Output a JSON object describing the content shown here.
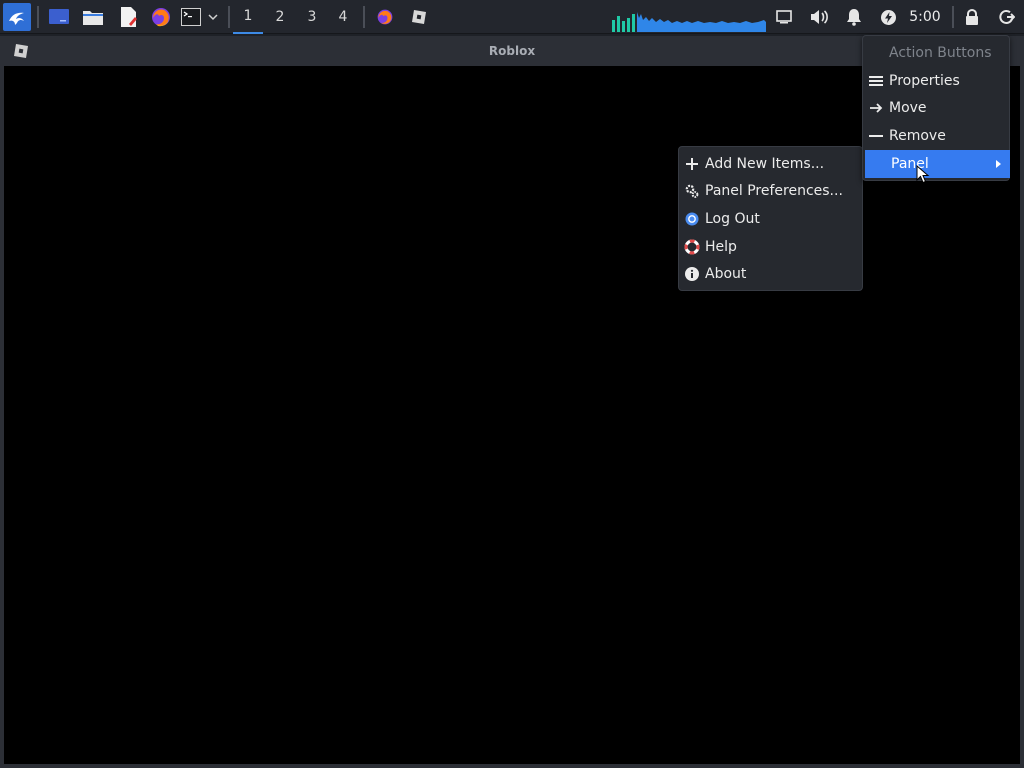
{
  "window": {
    "title": "Roblox"
  },
  "panel": {
    "workspaces": [
      "1",
      "2",
      "3",
      "4"
    ],
    "active_workspace": "1",
    "clock": "5:00",
    "accent_color": "#3d8ae6"
  },
  "context_menu": {
    "header": "Action Buttons",
    "items": [
      {
        "label": "Properties",
        "icon": "list-icon"
      },
      {
        "label": "Move",
        "icon": "arrow-right-icon"
      },
      {
        "label": "Remove",
        "icon": "minus-icon"
      },
      {
        "label": "Panel",
        "icon": "",
        "selected": true,
        "has_submenu": true
      }
    ]
  },
  "panel_submenu": {
    "items": [
      {
        "label": "Add New Items...",
        "icon": "plus-icon"
      },
      {
        "label": "Panel Preferences...",
        "icon": "gears-icon"
      },
      {
        "label": "Log Out",
        "icon": "logout-icon"
      },
      {
        "label": "Help",
        "icon": "lifebuoy-icon"
      },
      {
        "label": "About",
        "icon": "info-icon"
      }
    ]
  },
  "colors": {
    "selection": "#367bf0",
    "menu_bg": "#26292f",
    "panel_bg": "#23262d"
  }
}
